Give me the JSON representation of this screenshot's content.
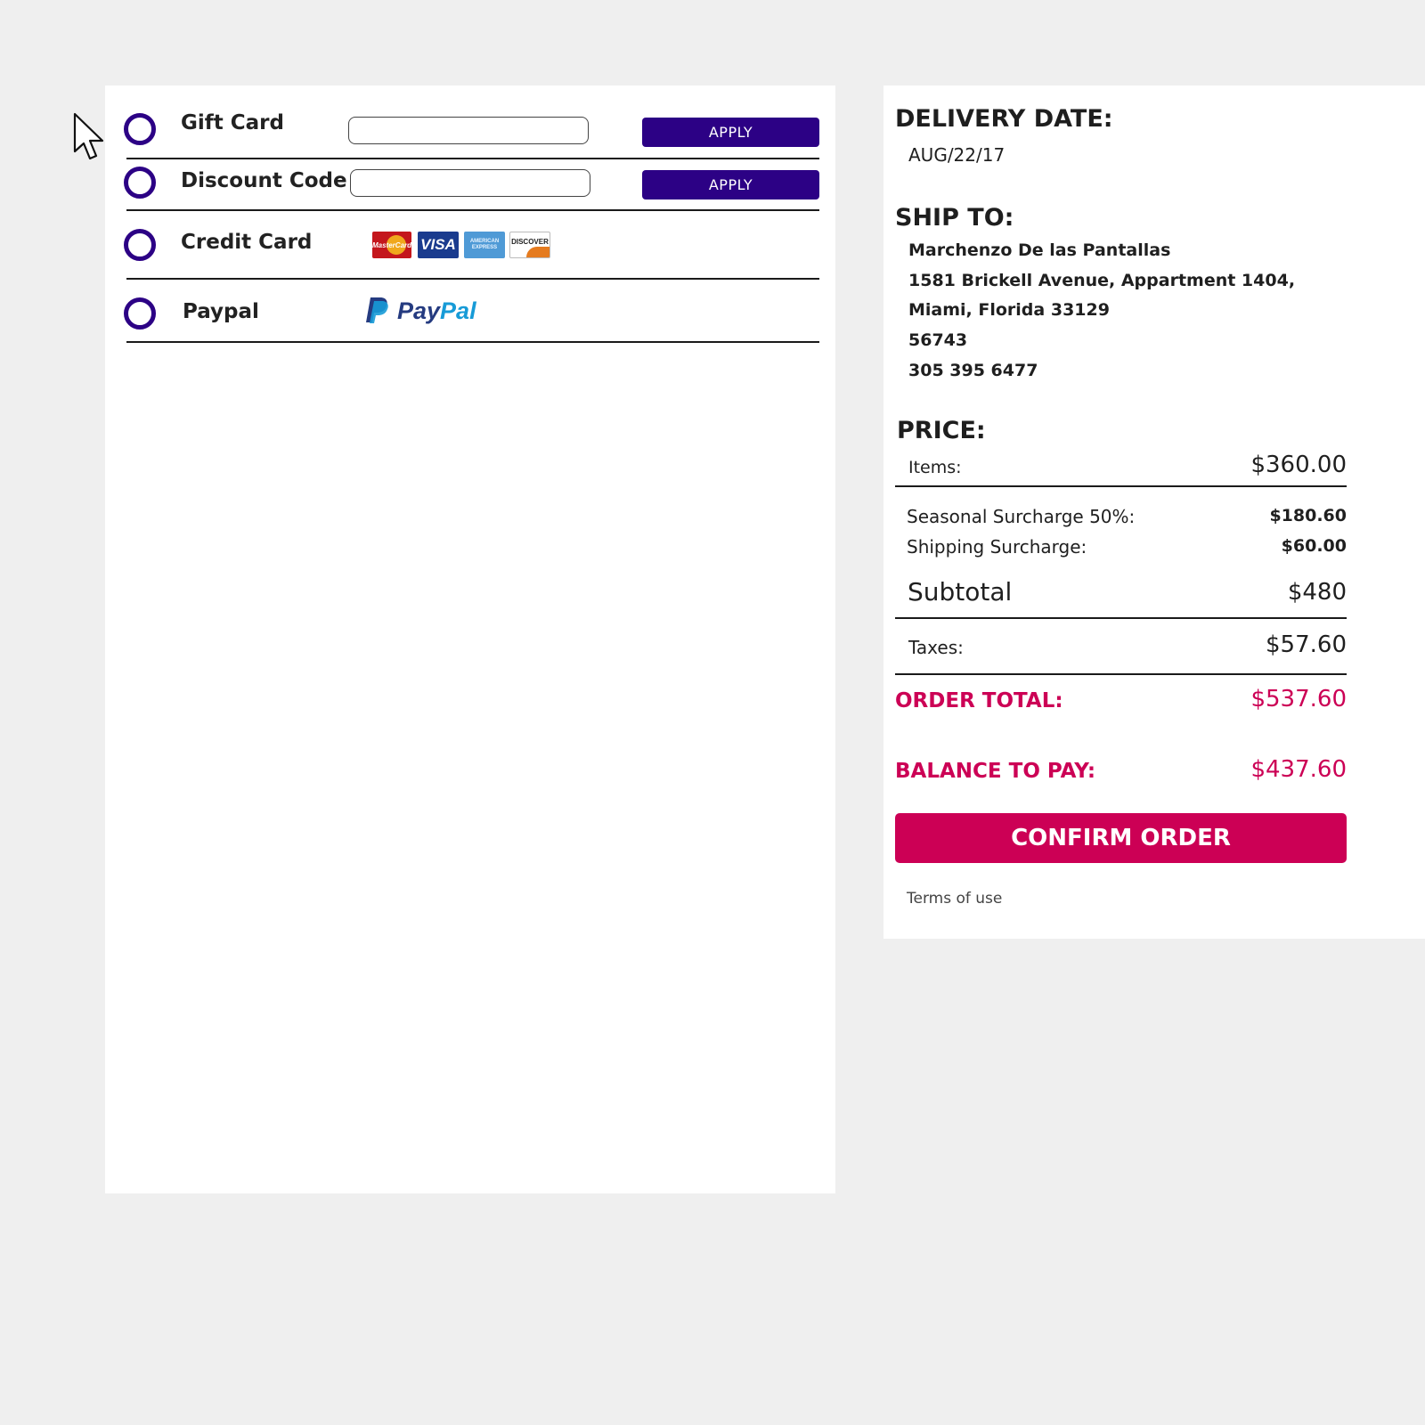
{
  "payment_methods": {
    "gift_card": {
      "label": "Gift Card",
      "input_value": "",
      "apply_label": "APPLY"
    },
    "discount_code": {
      "label": "Discount Code",
      "input_value": "",
      "apply_label": "APPLY"
    },
    "credit_card": {
      "label": "Credit Card",
      "cards": [
        {
          "name": "mastercard-icon",
          "text": "MasterCard"
        },
        {
          "name": "visa-icon",
          "text": "VISA"
        },
        {
          "name": "american-express-icon",
          "text": "AMERICAN EXPRESS"
        },
        {
          "name": "discover-icon",
          "text": "DISCOVER"
        }
      ]
    },
    "paypal": {
      "label": "Paypal",
      "logo_text": "PayPal"
    }
  },
  "summary": {
    "delivery": {
      "title": "DELIVERY DATE:",
      "date": "AUG/22/17"
    },
    "ship_to": {
      "title": "SHIP TO:",
      "lines": [
        "Marchenzo De las Pantallas",
        "1581 Brickell Avenue, Appartment 1404,",
        "Miami, Florida 33129",
        "56743",
        "305 395 6477"
      ]
    },
    "price": {
      "title": "PRICE:",
      "items_label": "Items:",
      "items_value": "$360.00",
      "seasonal_label": "Seasonal Surcharge 50%:",
      "seasonal_value": "$180.60",
      "shipping_label": "Shipping Surcharge:",
      "shipping_value": "$60.00",
      "subtotal_label": "Subtotal",
      "subtotal_value": "$480",
      "taxes_label": "Taxes:",
      "taxes_value": "$57.60",
      "total_label": "ORDER TOTAL:",
      "total_value": "$537.60",
      "balance_label": "BALANCE TO PAY:",
      "balance_value": "$437.60"
    },
    "confirm_label": "CONFIRM ORDER",
    "terms_label": "Terms of use"
  },
  "colors": {
    "primary": "#2c0185",
    "accent": "#cc0055",
    "background": "#efefef"
  }
}
